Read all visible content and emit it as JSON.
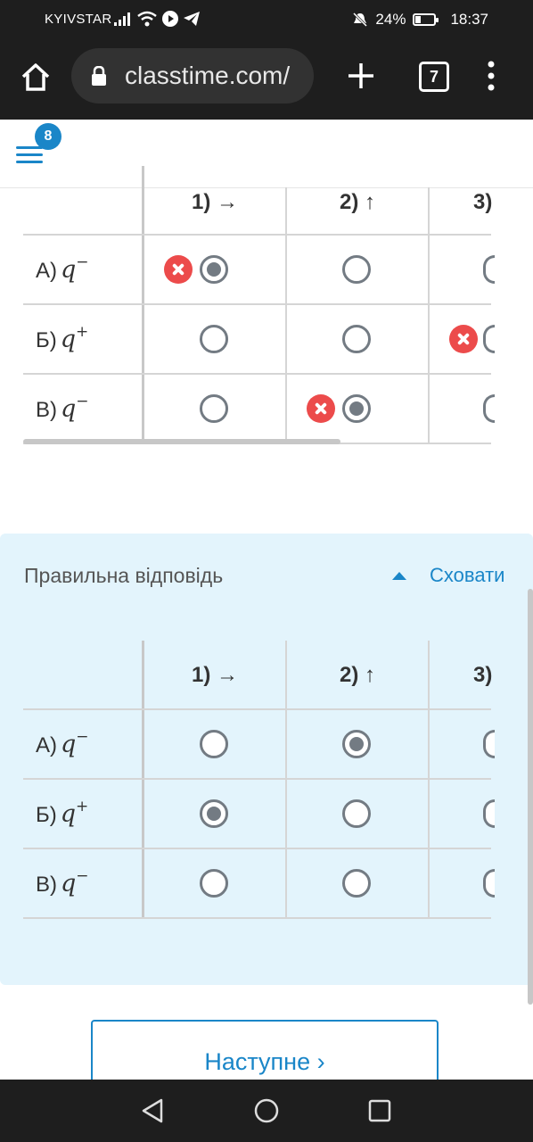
{
  "status_bar": {
    "carrier": "KYIVSTAR",
    "battery": "24%",
    "time": "18:37"
  },
  "browser": {
    "url": "classtime.com/",
    "tab_count": "7"
  },
  "app": {
    "notification_count": "8"
  },
  "matrix": {
    "columns": [
      "1) →",
      "2) ↑",
      "3)"
    ],
    "rows": [
      {
        "letter": "А)",
        "var": "q",
        "sign": "−"
      },
      {
        "letter": "Б)",
        "var": "q",
        "sign": "+"
      },
      {
        "letter": "В)",
        "var": "q",
        "sign": "−"
      }
    ]
  },
  "student_selection": {
    "rows": [
      1,
      null,
      2
    ],
    "wrong_marks": [
      [
        0,
        0
      ],
      [
        1,
        2
      ],
      [
        2,
        1
      ]
    ]
  },
  "correct_selection": {
    "rows": [
      2,
      1,
      null
    ]
  },
  "answer_panel": {
    "title": "Правильна відповідь",
    "toggle_label": "Сховати"
  },
  "next_button": {
    "label": "Наступне ›"
  },
  "colors": {
    "accent": "#1a86c8",
    "error": "#ec4b4b",
    "panel_bg": "#e3f4fc"
  }
}
